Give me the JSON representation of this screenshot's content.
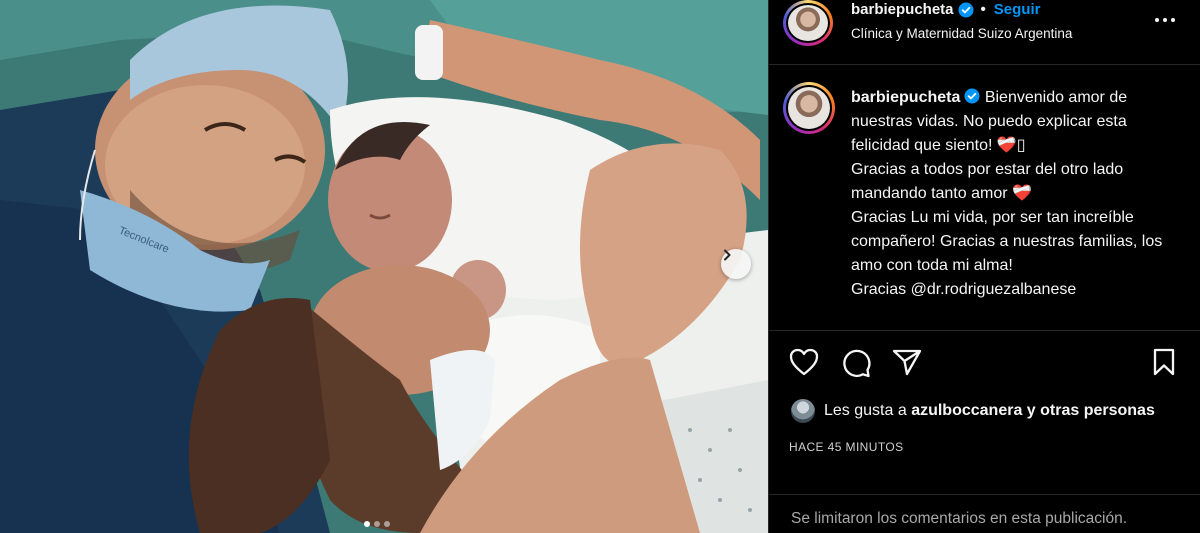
{
  "post": {
    "author": {
      "username": "barbiepucheta",
      "verified": true,
      "avatar": "profile-photo"
    },
    "follow_label": "Seguir",
    "separator": "•",
    "location": "Clínica y Maternidad Suizo Argentina",
    "more_icon": "more-horizontal-icon",
    "photo": {
      "description_icon": "newborn-family-photo",
      "carousel_next_icon": "chevron-right-icon",
      "carousel_total": 3,
      "carousel_active": 1,
      "mask_print": "Tecnolcare"
    },
    "caption": {
      "username": "barbiepucheta",
      "line1": "Bienvenido amor de nuestras vidas. No puedo explicar esta felicidad que siento! ",
      "emoji1": "❤️‍🩹",
      "emoji1_tail": "",
      "line2": "Gracias a todos por estar del otro lado mandando tanto amor ",
      "emoji2": "❤️‍🩹",
      "line3": "Gracias Lu mi vida, por ser tan increíble compañero! Gracias a nuestras familias, los amo con toda mi alma!",
      "line4": "Gracias @dr.rodriguezalbanese"
    },
    "actions": {
      "like_icon": "heart-icon",
      "comment_icon": "comment-icon",
      "share_icon": "send-icon",
      "save_icon": "bookmark-icon"
    },
    "likes": {
      "prefix": "Les gusta a",
      "user": "azulboccanera",
      "suffix": "y otras personas"
    },
    "timestamp": "HACE 45 MINUTOS",
    "comments_notice": "Se limitaron los comentarios en esta publicación."
  },
  "colors": {
    "background": "#000000",
    "link_blue": "#0095f6",
    "verified_blue": "#0095f6",
    "muted": "#a8a8a8",
    "divider": "#262626"
  }
}
